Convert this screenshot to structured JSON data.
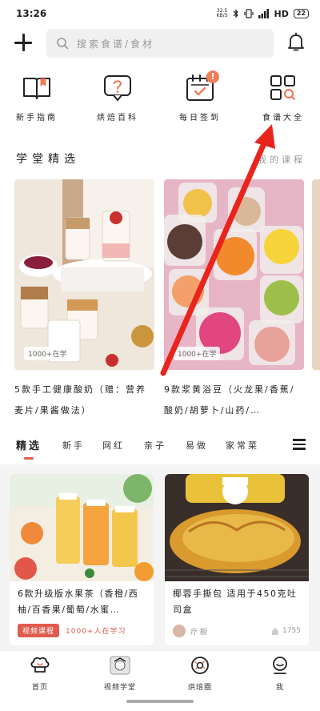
{
  "status_bar": {
    "time": "13:26",
    "speed": "32.5",
    "speed_unit": "KB/S",
    "network": "HD",
    "battery": "22"
  },
  "search": {
    "placeholder": "搜索食谱/食材"
  },
  "quick_entries": [
    {
      "label": "新手指南",
      "icon": "book-icon"
    },
    {
      "label": "烘焙百科",
      "icon": "question-bubble-icon"
    },
    {
      "label": "每日签到",
      "icon": "calendar-check-icon",
      "badge": "!"
    },
    {
      "label": "食谱大全",
      "icon": "grid-search-icon"
    }
  ],
  "academy": {
    "title": "学堂精选",
    "link": "我的课程",
    "cards": [
      {
        "tag": "1000+在学",
        "title": "5款手工健康酸奶（赠：营养麦片/果酱做法）"
      },
      {
        "tag": "1000+在学",
        "title": "9款浆黄浴豆（火龙果/香蕉/酸奶/胡萝卜/山药/…"
      }
    ]
  },
  "tabs": [
    "精选",
    "新手",
    "网红",
    "亲子",
    "易做",
    "家常菜"
  ],
  "feed": [
    {
      "title": "6款升级版水果茶（香橙/西柚/百香果/葡萄/水蜜…",
      "video_tag": "视频课程",
      "learners": "1000+人在学习"
    },
    {
      "title": "椰蓉手撕包 适用于450克吐司盒",
      "author": "疗 橱",
      "likes": "1755"
    }
  ],
  "bottom_nav": [
    {
      "label": "首页",
      "icon": "chef-hat-icon"
    },
    {
      "label": "视频学堂",
      "icon": "video-school-icon"
    },
    {
      "label": "烘焙圈",
      "icon": "donut-icon"
    },
    {
      "label": "我",
      "icon": "profile-icon"
    }
  ],
  "colors": {
    "accent": "#e05a4e",
    "badge": "#ef7d5a",
    "annotation_arrow": "#e8241c"
  }
}
